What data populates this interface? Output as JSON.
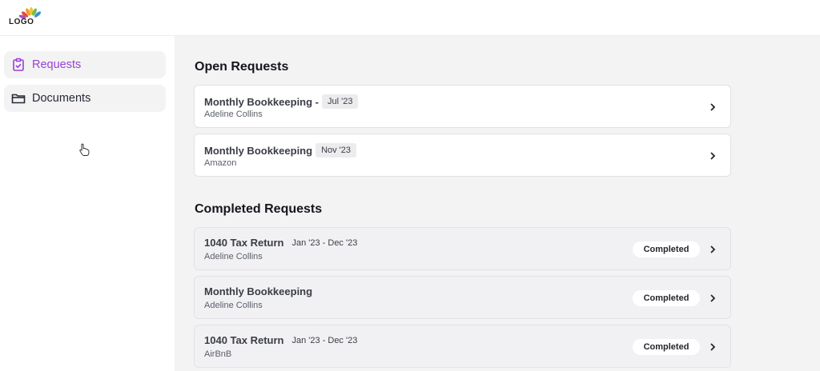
{
  "header": {
    "logo_text": "LOGO"
  },
  "sidebar": {
    "items": [
      {
        "label": "Requests",
        "icon": "clipboard-check-icon",
        "active": true
      },
      {
        "label": "Documents",
        "icon": "folder-icon",
        "active": false
      }
    ]
  },
  "main": {
    "open_title": "Open Requests",
    "open_requests": [
      {
        "title": "Monthly Bookkeeping -",
        "tag": "Jul '23",
        "client": "Adeline Collins"
      },
      {
        "title": "Monthly Bookkeeping",
        "tag": "Nov '23",
        "client": "Amazon"
      }
    ],
    "completed_title": "Completed Requests",
    "completed_requests": [
      {
        "title": "1040 Tax Return",
        "period": "Jan '23 - Dec '23",
        "client": "Adeline Collins",
        "status": "Completed"
      },
      {
        "title": "Monthly Bookkeeping",
        "period": "",
        "client": "Adeline Collins",
        "status": "Completed"
      },
      {
        "title": "1040 Tax Return",
        "period": "Jan '23 - Dec '23",
        "client": "AirBnB",
        "status": "Completed"
      }
    ]
  },
  "colors": {
    "accent": "#9b3fd6",
    "background": "#f3f3f4",
    "card": "#ffffff"
  }
}
